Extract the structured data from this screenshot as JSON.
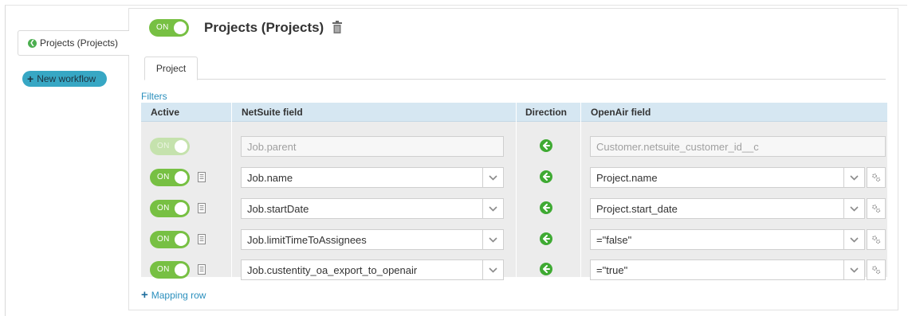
{
  "sidebar": {
    "workflow_tab_label": "Projects (Projects)",
    "new_workflow_label": "New workflow"
  },
  "header": {
    "toggle_label": "ON",
    "title": "Projects (Projects)"
  },
  "tabs": [
    {
      "label": "Project"
    }
  ],
  "filters_label": "Filters",
  "grid": {
    "columns": {
      "active": "Active",
      "netsuite": "NetSuite field",
      "direction": "Direction",
      "openair": "OpenAir field"
    },
    "rows": [
      {
        "toggle": "ON",
        "netsuite": "Job.parent",
        "openair": "Customer.netsuite_customer_id__c",
        "readonly": true
      },
      {
        "toggle": "ON",
        "netsuite": "Job.name",
        "openair": "Project.name",
        "readonly": false
      },
      {
        "toggle": "ON",
        "netsuite": "Job.startDate",
        "openair": "Project.start_date",
        "readonly": false
      },
      {
        "toggle": "ON",
        "netsuite": "Job.limitTimeToAssignees",
        "openair": "=\"false\"",
        "readonly": false
      },
      {
        "toggle": "ON",
        "netsuite": "Job.custentity_oa_export_to_openair",
        "openair": "=\"true\"",
        "readonly": false
      }
    ]
  },
  "mapping_row_label": "Mapping row",
  "colors": {
    "toggle_on": "#77c043",
    "toggle_disabled": "#c5e2ad",
    "header_blue": "#d6e7f2",
    "link_blue": "#2a8fbd",
    "new_workflow_bg": "#37a7c4",
    "direction_green": "#3faa33"
  },
  "icons": {
    "trash": "trash-icon",
    "copy": "copy-icon",
    "direction": "arrow-left-circle-icon",
    "dropdown": "chevron-down-icon",
    "settings": "gear-icon"
  }
}
